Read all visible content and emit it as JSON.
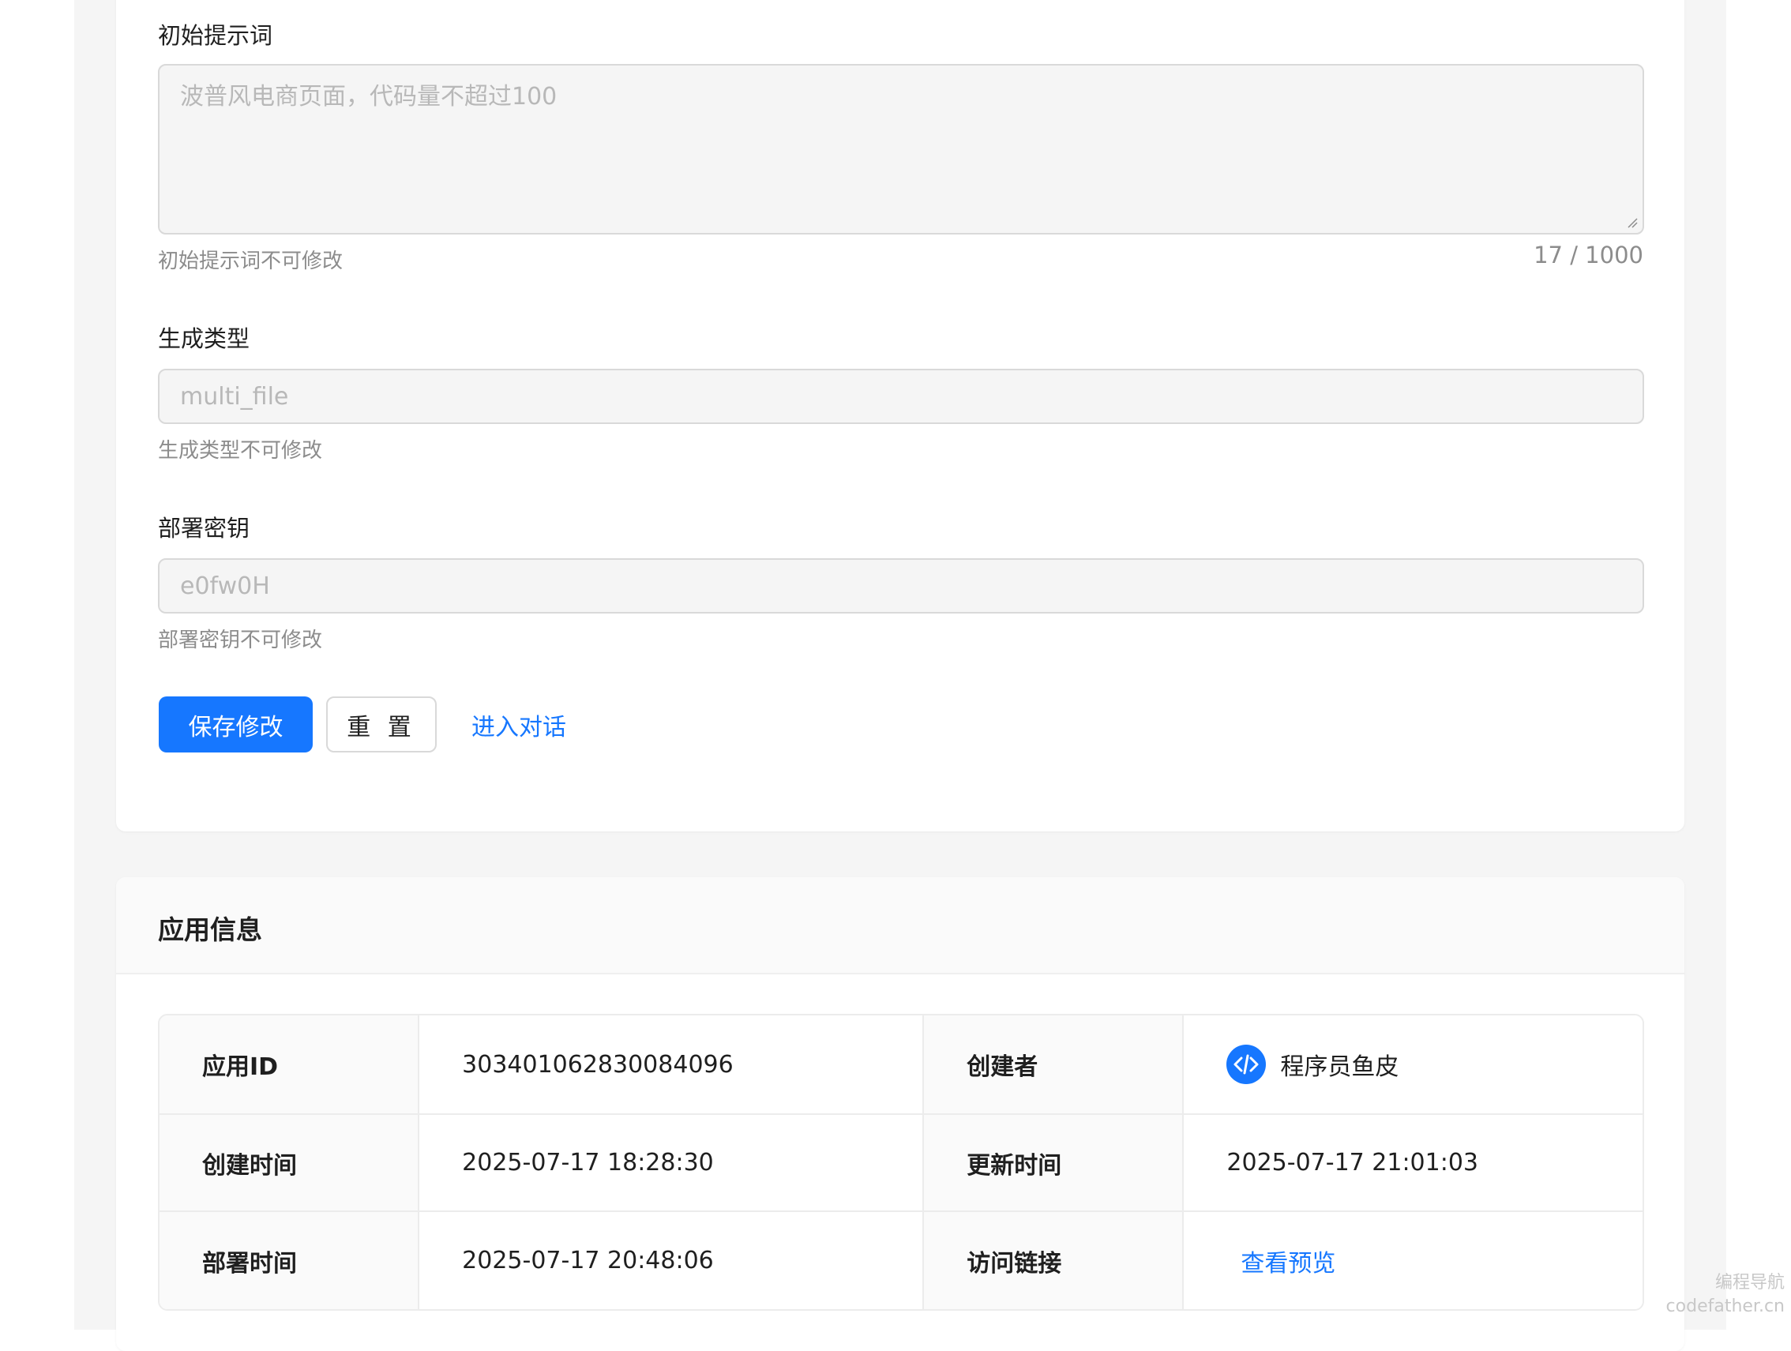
{
  "form": {
    "prompt": {
      "label": "初始提示词",
      "placeholder": "波普风电商页面，代码量不超过100",
      "help": "初始提示词不可修改",
      "counter": "17 / 1000"
    },
    "gen_type": {
      "label": "生成类型",
      "value": "multi_file",
      "help": "生成类型不可修改"
    },
    "deploy_key": {
      "label": "部署密钥",
      "value": "e0fw0H",
      "help": "部署密钥不可修改"
    },
    "actions": {
      "save": "保存修改",
      "reset": "重 置",
      "chat": "进入对话"
    }
  },
  "app_info": {
    "title": "应用信息",
    "rows": [
      {
        "label1": "应用ID",
        "value1": "303401062830084096",
        "label2": "创建者",
        "value2": "程序员鱼皮"
      },
      {
        "label1": "创建时间",
        "value1": "2025-07-17 18:28:30",
        "label2": "更新时间",
        "value2": "2025-07-17 21:01:03"
      },
      {
        "label1": "部署时间",
        "value1": "2025-07-17 20:48:06",
        "label2": "访问链接",
        "value2": "查看预览"
      }
    ],
    "creator_avatar_icon": "code-avatar-icon"
  },
  "watermark": {
    "line1": "编程导航",
    "line2": "codefather.cn"
  },
  "colors": {
    "primary": "#1677ff",
    "page_bg": "#f5f5f5"
  }
}
